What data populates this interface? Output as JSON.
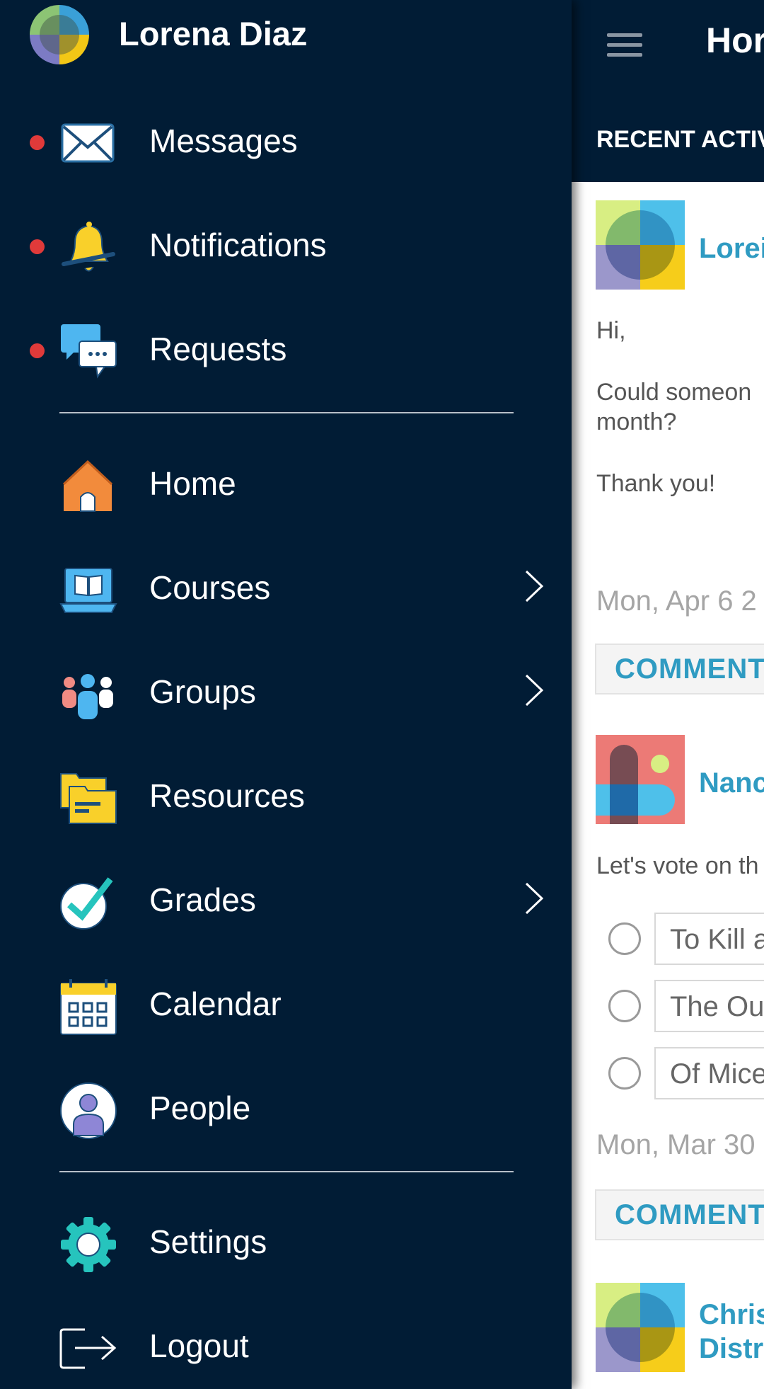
{
  "page": {
    "title": "Hor",
    "section_heading": "RECENT ACTIV",
    "posts": [
      {
        "author": "Lorei",
        "body_lines": [
          "Hi,",
          "Could someon",
          "month?",
          "Thank you!"
        ],
        "date": "Mon, Apr 6 2",
        "comment_label": "COMMENT"
      },
      {
        "author": "Nanc",
        "body_lines": [
          "Let's vote on th"
        ],
        "options": [
          "To Kill a",
          "The Ou",
          "Of Mice"
        ],
        "date": "Mon, Mar 30",
        "comment_label": "COMMENT"
      },
      {
        "author_lines": [
          "Chris",
          "Distr"
        ]
      }
    ]
  },
  "drawer": {
    "user_name": "Lorena Diaz",
    "alerts": [
      {
        "label": "Messages",
        "icon": "envelope-icon",
        "unread": true
      },
      {
        "label": "Notifications",
        "icon": "bell-icon",
        "unread": true
      },
      {
        "label": "Requests",
        "icon": "chat-bubbles-icon",
        "unread": true
      }
    ],
    "nav": [
      {
        "label": "Home",
        "icon": "house-icon"
      },
      {
        "label": "Courses",
        "icon": "laptop-book-icon",
        "has_submenu": true
      },
      {
        "label": "Groups",
        "icon": "people-group-icon",
        "has_submenu": true
      },
      {
        "label": "Resources",
        "icon": "folders-icon"
      },
      {
        "label": "Grades",
        "icon": "checkmark-icon",
        "has_submenu": true
      },
      {
        "label": "Calendar",
        "icon": "calendar-icon"
      },
      {
        "label": "People",
        "icon": "person-icon"
      }
    ],
    "account": [
      {
        "label": "Settings",
        "icon": "gear-icon"
      },
      {
        "label": "Logout",
        "icon": "logout-icon"
      }
    ]
  },
  "colors": {
    "drawer_bg": "#011c35",
    "accent": "#2f9bc2",
    "unread_dot": "#e03a3a"
  }
}
